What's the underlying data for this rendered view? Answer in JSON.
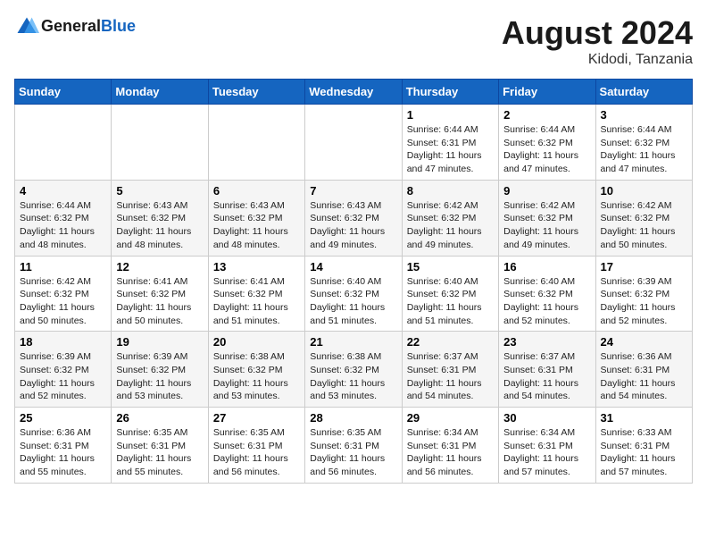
{
  "header": {
    "logo_text_general": "General",
    "logo_text_blue": "Blue",
    "month_year": "August 2024",
    "location": "Kidodi, Tanzania"
  },
  "days_of_week": [
    "Sunday",
    "Monday",
    "Tuesday",
    "Wednesday",
    "Thursday",
    "Friday",
    "Saturday"
  ],
  "weeks": [
    [
      {
        "day": "",
        "info": ""
      },
      {
        "day": "",
        "info": ""
      },
      {
        "day": "",
        "info": ""
      },
      {
        "day": "",
        "info": ""
      },
      {
        "day": "1",
        "info": "Sunrise: 6:44 AM\nSunset: 6:31 PM\nDaylight: 11 hours\nand 47 minutes."
      },
      {
        "day": "2",
        "info": "Sunrise: 6:44 AM\nSunset: 6:32 PM\nDaylight: 11 hours\nand 47 minutes."
      },
      {
        "day": "3",
        "info": "Sunrise: 6:44 AM\nSunset: 6:32 PM\nDaylight: 11 hours\nand 47 minutes."
      }
    ],
    [
      {
        "day": "4",
        "info": "Sunrise: 6:44 AM\nSunset: 6:32 PM\nDaylight: 11 hours\nand 48 minutes."
      },
      {
        "day": "5",
        "info": "Sunrise: 6:43 AM\nSunset: 6:32 PM\nDaylight: 11 hours\nand 48 minutes."
      },
      {
        "day": "6",
        "info": "Sunrise: 6:43 AM\nSunset: 6:32 PM\nDaylight: 11 hours\nand 48 minutes."
      },
      {
        "day": "7",
        "info": "Sunrise: 6:43 AM\nSunset: 6:32 PM\nDaylight: 11 hours\nand 49 minutes."
      },
      {
        "day": "8",
        "info": "Sunrise: 6:42 AM\nSunset: 6:32 PM\nDaylight: 11 hours\nand 49 minutes."
      },
      {
        "day": "9",
        "info": "Sunrise: 6:42 AM\nSunset: 6:32 PM\nDaylight: 11 hours\nand 49 minutes."
      },
      {
        "day": "10",
        "info": "Sunrise: 6:42 AM\nSunset: 6:32 PM\nDaylight: 11 hours\nand 50 minutes."
      }
    ],
    [
      {
        "day": "11",
        "info": "Sunrise: 6:42 AM\nSunset: 6:32 PM\nDaylight: 11 hours\nand 50 minutes."
      },
      {
        "day": "12",
        "info": "Sunrise: 6:41 AM\nSunset: 6:32 PM\nDaylight: 11 hours\nand 50 minutes."
      },
      {
        "day": "13",
        "info": "Sunrise: 6:41 AM\nSunset: 6:32 PM\nDaylight: 11 hours\nand 51 minutes."
      },
      {
        "day": "14",
        "info": "Sunrise: 6:40 AM\nSunset: 6:32 PM\nDaylight: 11 hours\nand 51 minutes."
      },
      {
        "day": "15",
        "info": "Sunrise: 6:40 AM\nSunset: 6:32 PM\nDaylight: 11 hours\nand 51 minutes."
      },
      {
        "day": "16",
        "info": "Sunrise: 6:40 AM\nSunset: 6:32 PM\nDaylight: 11 hours\nand 52 minutes."
      },
      {
        "day": "17",
        "info": "Sunrise: 6:39 AM\nSunset: 6:32 PM\nDaylight: 11 hours\nand 52 minutes."
      }
    ],
    [
      {
        "day": "18",
        "info": "Sunrise: 6:39 AM\nSunset: 6:32 PM\nDaylight: 11 hours\nand 52 minutes."
      },
      {
        "day": "19",
        "info": "Sunrise: 6:39 AM\nSunset: 6:32 PM\nDaylight: 11 hours\nand 53 minutes."
      },
      {
        "day": "20",
        "info": "Sunrise: 6:38 AM\nSunset: 6:32 PM\nDaylight: 11 hours\nand 53 minutes."
      },
      {
        "day": "21",
        "info": "Sunrise: 6:38 AM\nSunset: 6:32 PM\nDaylight: 11 hours\nand 53 minutes."
      },
      {
        "day": "22",
        "info": "Sunrise: 6:37 AM\nSunset: 6:31 PM\nDaylight: 11 hours\nand 54 minutes."
      },
      {
        "day": "23",
        "info": "Sunrise: 6:37 AM\nSunset: 6:31 PM\nDaylight: 11 hours\nand 54 minutes."
      },
      {
        "day": "24",
        "info": "Sunrise: 6:36 AM\nSunset: 6:31 PM\nDaylight: 11 hours\nand 54 minutes."
      }
    ],
    [
      {
        "day": "25",
        "info": "Sunrise: 6:36 AM\nSunset: 6:31 PM\nDaylight: 11 hours\nand 55 minutes."
      },
      {
        "day": "26",
        "info": "Sunrise: 6:35 AM\nSunset: 6:31 PM\nDaylight: 11 hours\nand 55 minutes."
      },
      {
        "day": "27",
        "info": "Sunrise: 6:35 AM\nSunset: 6:31 PM\nDaylight: 11 hours\nand 56 minutes."
      },
      {
        "day": "28",
        "info": "Sunrise: 6:35 AM\nSunset: 6:31 PM\nDaylight: 11 hours\nand 56 minutes."
      },
      {
        "day": "29",
        "info": "Sunrise: 6:34 AM\nSunset: 6:31 PM\nDaylight: 11 hours\nand 56 minutes."
      },
      {
        "day": "30",
        "info": "Sunrise: 6:34 AM\nSunset: 6:31 PM\nDaylight: 11 hours\nand 57 minutes."
      },
      {
        "day": "31",
        "info": "Sunrise: 6:33 AM\nSunset: 6:31 PM\nDaylight: 11 hours\nand 57 minutes."
      }
    ]
  ]
}
